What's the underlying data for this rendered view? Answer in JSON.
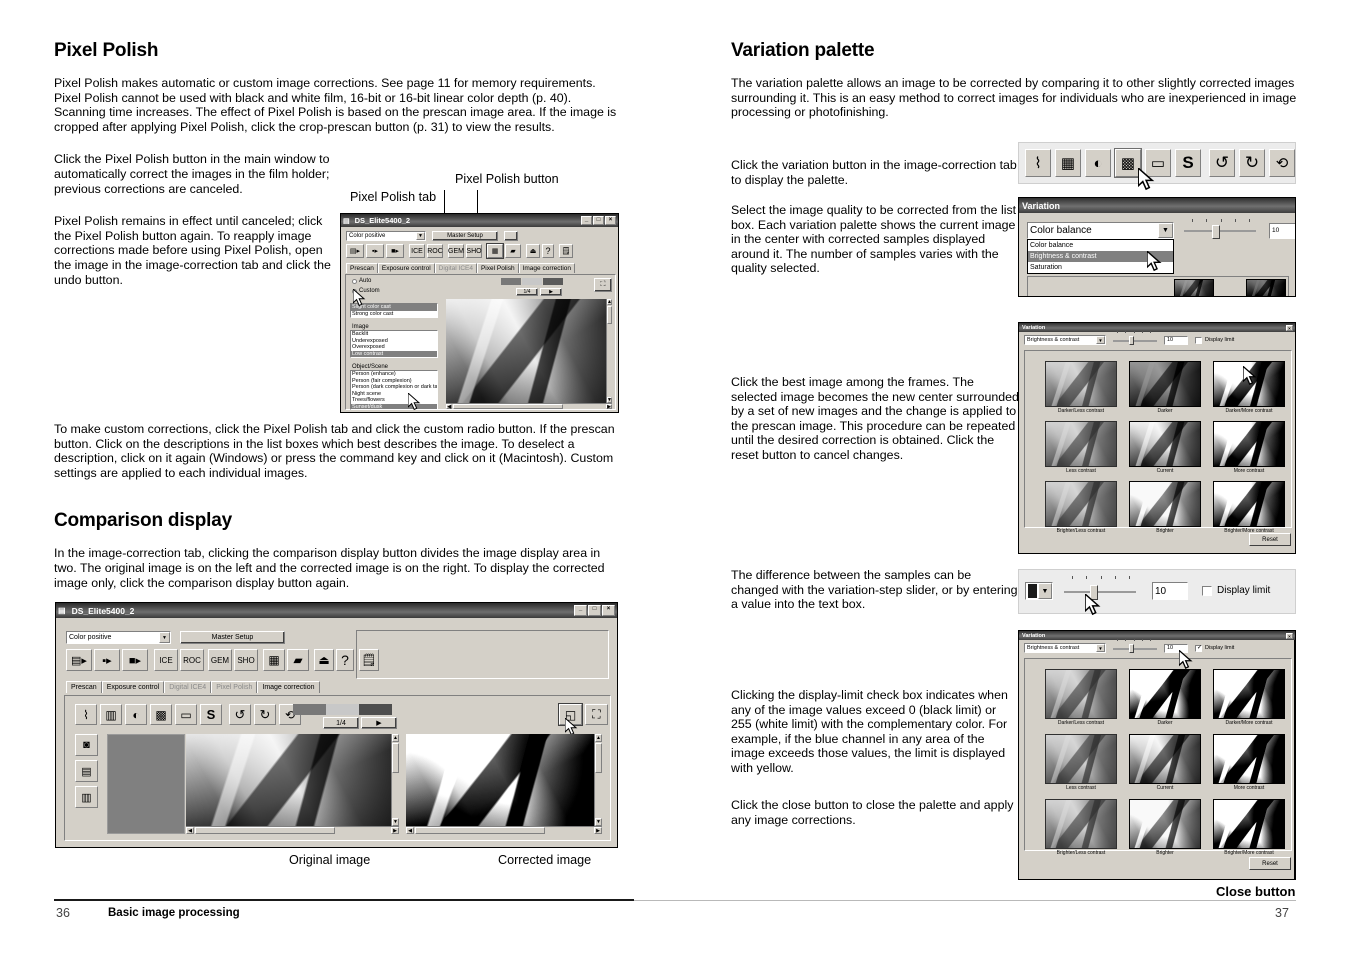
{
  "left": {
    "heading1": "Pixel Polish",
    "p1": "Pixel Polish makes automatic or custom image corrections. See page 11 for memory  requirements. Pixel Polish cannot be used with black and white film, 16-bit or 16-bit linear color depth (p. 40). Scanning time increases. The effect of Pixel Polish is based on the prescan image area. If the image is cropped after applying Pixel Polish, click the crop-prescan button (p. 31) to view the results.",
    "p2": "Click the Pixel Polish button in the main window to automatically correct the images in the film holder; previous corrections are canceled.",
    "p3": "Pixel Polish remains in effect until canceled; click the Pixel Polish button again. To reapply image corrections made before using Pixel Polish, open the image in the image-correction tab and click the undo button.",
    "p4": "To make custom corrections, click the Pixel Polish tab and click the custom radio button. If the prescan button. Click on the descriptions in the list boxes which best describes the image. To deselect a description, click on it again (Windows) or press the command key and click on it (Macintosh). Custom settings are applied to each individual images.",
    "heading2": "Comparison display",
    "p5": "In the image-correction tab, clicking the comparison display button divides the image display area in two. The original image is on the left and the corrected image is on the right. To display the corrected image only, click the comparison display button again.",
    "callout_tab": "Pixel Polish tab",
    "callout_button": "Pixel Polish button",
    "caption_original": "Original image",
    "caption_corrected": "Corrected image"
  },
  "right": {
    "heading1": "Variation palette",
    "p1": "The variation palette allows an image to be corrected by comparing it to other slightly corrected images surrounding it. This is an easy method to correct images for individuals who are inexperienced in image processing or photofinishing.",
    "p2": "Click the variation button in the image-correction tab to display the palette.",
    "p3": "Select the image quality to be corrected from the list box. Each variation palette shows the current image in the center with corrected samples displayed around it. The number of samples varies with the quality selected.",
    "p4": "Click the best image among the frames. The selected image becomes the new center surrounded by a set of new images and the change is applied to the prescan image. This procedure can be repeated until the desired correction is obtained. Click the reset button to cancel changes.",
    "p5": "The difference between the samples can be changed with the variation-step slider, or by entering a value into the text box.",
    "p6": "Clicking the display-limit check box  indicates when any of the image values exceed 0 (black limit) or 255 (white limit) with the complementary color. For example, if the blue channel in any area of the image exceeds those values, the limit is displayed with yellow.",
    "p7": "Click the close button to close the palette and apply any image corrections.",
    "callout_close": "Close button"
  },
  "scanner_window_1": {
    "title": "DS_Elite5400_2",
    "media_select": "Color positive",
    "master_setup": "Master Setup",
    "minimize": "_",
    "maximize": "□",
    "close": "×",
    "tabs": [
      "Prescan",
      "Exposure control",
      "Digital ICE4",
      "Pixel Polish",
      "Image correction"
    ],
    "active_tab": "Pixel Polish",
    "radio_auto": "Auto",
    "radio_custom": "Custom",
    "group_colorcast": {
      "items": [
        "Slight color cast",
        "Strong color cast"
      ],
      "selected": "Slight color cast"
    },
    "group_image": {
      "label": "Image",
      "items": [
        "Backlit",
        "Underexposed",
        "Overexposed",
        "Low contrast"
      ],
      "selected": "Low contrast"
    },
    "group_object": {
      "label": "Object/Scene",
      "items": [
        "Person (enhance)",
        "Person (fair complexion)",
        "Person (dark complexion or dark tan)",
        "Night scene",
        "Trees/flowers",
        "Sunset/dusk"
      ],
      "selected": "Sunset/dusk"
    },
    "zoom_label": "1/4",
    "play": "▶"
  },
  "scanner_window_2": {
    "title": "DS_Elite5400_2",
    "media_select": "Color positive",
    "master_setup": "Master Setup",
    "minimize": "_",
    "maximize": "□",
    "close": "×",
    "tabs": [
      "Prescan",
      "Exposure control",
      "Digital ICE4",
      "Pixel Polish",
      "Image correction"
    ],
    "active_tab": "Image correction",
    "toolbar_icons": [
      "tone-curve-icon",
      "histogram-icon",
      "brightness-contrast-icon",
      "variation-icon",
      "hue-saturation-icon",
      "selective-color-icon",
      "undo-icon",
      "redo-icon",
      "reset-icon"
    ],
    "right_icons": [
      "comparison-display-icon",
      "fullscreen-display-icon"
    ],
    "side_icons": [
      "snapshot-icon",
      "save-correction-icon",
      "load-correction-icon"
    ],
    "zoom_label": "1/4",
    "play": "▶"
  },
  "toolbar_callout": {
    "icons": [
      "tone-curve-icon",
      "histogram-icon",
      "brightness-contrast-icon",
      "variation-icon",
      "hue-saturation-icon",
      "selective-color-icon",
      "undo-icon",
      "redo-icon",
      "reset-icon"
    ]
  },
  "variation_dialog_top": {
    "title": "Variation",
    "combo_value": "Color balance",
    "step_value": "10",
    "dropdown_options": [
      "Color balance",
      "Brightness & contrast",
      "Saturation"
    ],
    "dropdown_highlighted": "Brightness & contrast"
  },
  "variation_palette_1": {
    "title": "Variation",
    "combo_value": "Brightness & contrast",
    "step_value": "10",
    "display_limit_label": "Display limit",
    "display_limit_checked": false,
    "reset_label": "Reset",
    "cells": [
      "Darker/Less contrast",
      "Darker",
      "Darker/More contrast",
      "Less contrast",
      "Current",
      "More contrast",
      "Brighter/Less contrast",
      "Brighter",
      "Brighter/More contrast"
    ]
  },
  "variation_slider_callout": {
    "step_value": "10",
    "display_limit_label": "Display limit"
  },
  "variation_palette_2": {
    "title": "Variation",
    "combo_value": "Brightness & contrast",
    "step_value": "10",
    "display_limit_label": "Display limit",
    "display_limit_checked": true,
    "reset_label": "Reset",
    "cells": [
      "Darker/Less contrast",
      "Darker",
      "Darker/More contrast",
      "Less contrast",
      "Current",
      "More contrast",
      "Brighter/Less contrast",
      "Brighter",
      "Brighter/More contrast"
    ]
  },
  "footer": {
    "page_left": "36",
    "section": "Basic image processing",
    "page_right": "37"
  }
}
